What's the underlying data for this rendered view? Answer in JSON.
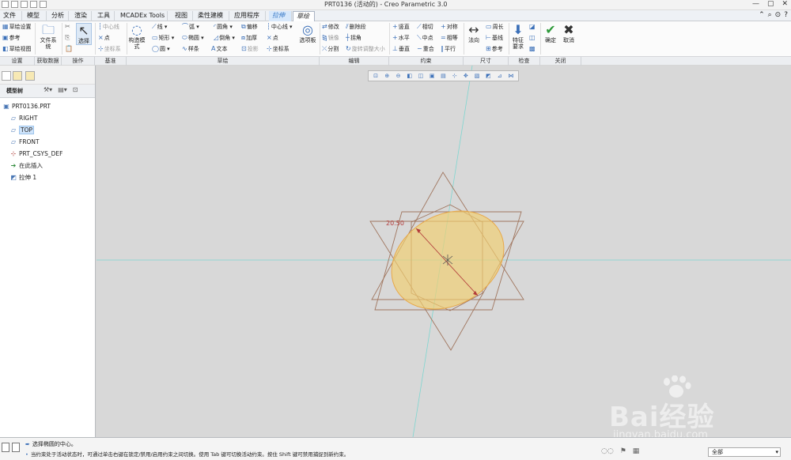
{
  "title": "PRT0136 (活动的) - Creo Parametric 3.0",
  "menu_tabs": [
    "文件",
    "模型",
    "分析",
    "渲染",
    "工具",
    "MCADEx Tools",
    "视图",
    "柔性建模",
    "应用程序",
    "拉伸",
    "草绘"
  ],
  "ribbon": {
    "settings": {
      "sketch_setup": "草绘设置",
      "reference": "参考",
      "sketch_view": "草绘视图"
    },
    "get_data": {
      "file_system": "文件系统"
    },
    "operations": {
      "select": "选择"
    },
    "datum": {
      "centerline": "中心线",
      "point": "点",
      "coord_sys": "坐标系"
    },
    "sketch": {
      "line": "线",
      "arc": "弧",
      "fillet": "圆角",
      "offset": "偏移",
      "centerline": "中心线",
      "rectangle": "矩形",
      "ellipse": "椭圆",
      "chamfer": "倒角",
      "thicken": "加厚",
      "point": "点",
      "circle": "圆",
      "spline": "样条",
      "text": "文本",
      "project": "投影",
      "coord_sys": "坐标系",
      "construction_mode": "构造模式",
      "palette": "选项板"
    },
    "editing": {
      "modify": "修改",
      "delete_segment": "删除段",
      "mirror": "镜像",
      "corner": "拐角",
      "divide": "分割",
      "rotate_resize": "旋转调整大小"
    },
    "constrain": {
      "vertical": "竖直",
      "tangent": "相切",
      "symmetric": "对称",
      "horizontal": "水平",
      "midpoint": "中点",
      "equal": "相等",
      "perpendicular": "垂直",
      "coincident": "重合",
      "parallel": "平行"
    },
    "dimension": {
      "normal": "法向",
      "perimeter": "周长",
      "baseline": "基线",
      "reference": "参考"
    },
    "inspect": {
      "feature_requirements": "特征要求"
    },
    "close": {
      "ok": "确定",
      "cancel": "取消"
    },
    "groups": [
      "设置",
      "获取数据",
      "操作",
      "基准",
      "草绘",
      "编辑",
      "约束",
      "尺寸",
      "检查",
      "关闭"
    ]
  },
  "model_tree": {
    "header": "模型树",
    "items": [
      {
        "label": "PRT0136.PRT",
        "icon": "part-icon"
      },
      {
        "label": "RIGHT",
        "icon": "datum-plane-icon"
      },
      {
        "label": "TOP",
        "icon": "datum-plane-icon",
        "selected": true
      },
      {
        "label": "FRONT",
        "icon": "datum-plane-icon"
      },
      {
        "label": "PRT_CSYS_DEF",
        "icon": "csys-icon"
      },
      {
        "label": "在此插入",
        "icon": "insert-here-icon"
      },
      {
        "label": "拉伸 1",
        "icon": "extrude-icon"
      }
    ]
  },
  "canvas": {
    "dimension_value": "20.50"
  },
  "status": {
    "line1": "选择椭圆的中心。",
    "line2": "当约束处于活动状态时，可通过单击右键在锁定/禁用/启用约束之间切换。使用 Tab 键可切换活动约束。按住 Shift 键可禁用捕捉到新约束。",
    "filter": "全部"
  },
  "watermark": {
    "text": "Bai经验",
    "url": "jingyan.baidu.com"
  },
  "colors": {
    "ellipse_fill": "#f2cf6e",
    "ellipse_stroke": "#e8a94a",
    "sketch_line": "#a0765f",
    "dimension": "#b23a3a",
    "axis": "#7fd6d0"
  }
}
